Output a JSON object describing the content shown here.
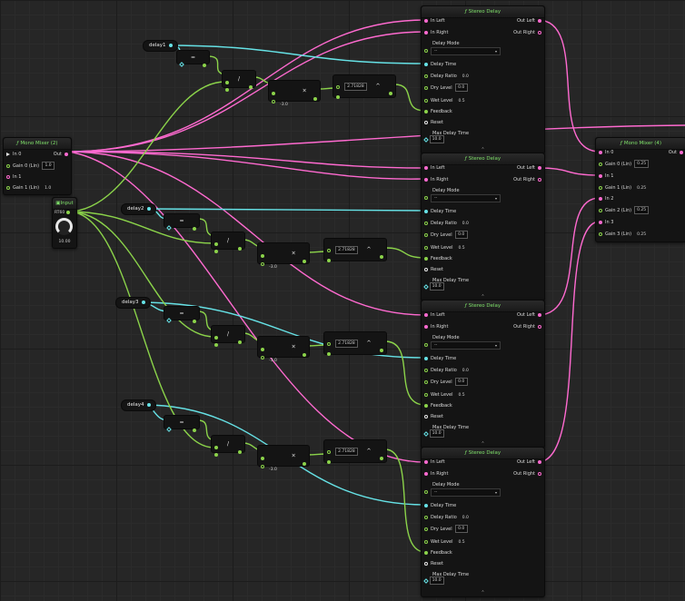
{
  "mono_mixer_2": {
    "title": "Mono Mixer (2)",
    "in0": "In 0",
    "out": "Out",
    "gain0_label": "Gain 0 (Lin)",
    "gain0_value": "1.0",
    "in1": "In 1",
    "gain1_label": "Gain 1 (Lin)",
    "gain1_value": "1.0"
  },
  "input_node": {
    "title": "Input",
    "pin_label": "RT60",
    "knob_value": "10.00"
  },
  "variables": [
    "delay1",
    "delay2",
    "delay3",
    "delay4"
  ],
  "math_ops": {
    "equals": "=",
    "divide": "/",
    "multiply": "×",
    "power": "^",
    "neg_const": "-3.0",
    "e_const": "2.71828"
  },
  "stereo_delay": {
    "title": "Stereo Delay",
    "in_left": "In Left",
    "in_right": "In Right",
    "out_left": "Out Left",
    "out_right": "Out Right",
    "delay_mode": "Delay Mode",
    "delay_mode_value": "--",
    "delay_time": "Delay Time",
    "delay_ratio": "Delay Ratio",
    "delay_ratio_value": "0.0",
    "dry_level": "Dry Level",
    "dry_level_value": "0.0",
    "wet_level": "Wet Level",
    "wet_level_value": "0.5",
    "feedback": "Feedback",
    "reset": "Reset",
    "max_delay_time": "Max Delay Time",
    "max_delay_time_value": "10.0"
  },
  "mono_mixer_4": {
    "title": "Mono Mixer (4)",
    "in0": "In 0",
    "out": "Out",
    "gain0_label": "Gain 0 (Lin)",
    "gain0_value": "0.25",
    "in1": "In 1",
    "gain1_label": "Gain 1 (Lin)",
    "gain1_value": "0.25",
    "in2": "In 2",
    "gain2_label": "Gain 2 (Lin)",
    "gain2_value": "0.25",
    "in3": "In 3",
    "gain3_label": "Gain 3 (Lin)",
    "gain3_value": "0.25"
  },
  "colors": {
    "audio_wire": "#ff6ad0",
    "float_wire": "#8bd34a",
    "time_wire": "#66e2e6",
    "background": "#262626",
    "node_body": "#141414"
  }
}
